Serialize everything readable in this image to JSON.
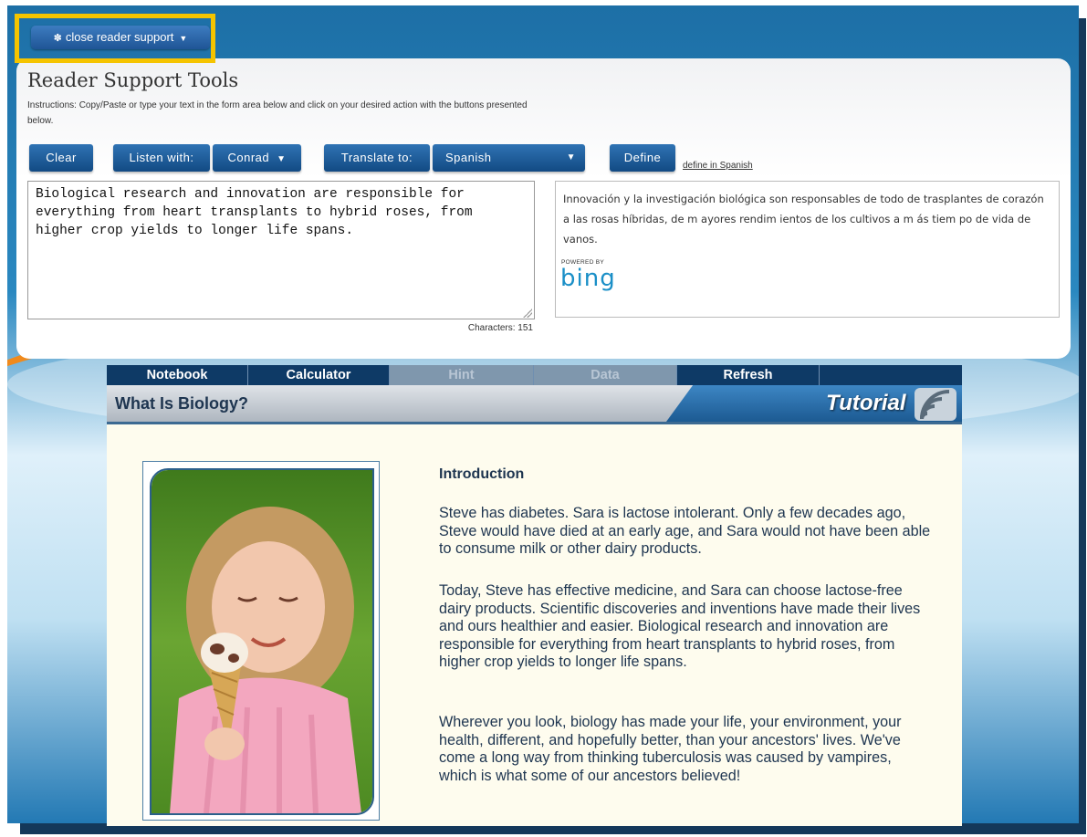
{
  "reader_support": {
    "close_label": "close reader support",
    "title": "Reader Support Tools",
    "instructions": "Instructions: Copy/Paste or type your text in the form area below and click on your desired action with the buttons presented below.",
    "clear_label": "Clear",
    "listen_label": "Listen with:",
    "voice": "Conrad",
    "translate_label": "Translate to:",
    "language": "Spanish",
    "define_label": "Define",
    "define_link": "define in Spanish",
    "input_text": "Biological research and innovation are responsible for everything from heart transplants to hybrid roses, from higher crop yields to longer life spans.",
    "char_count": "Characters: 151",
    "translation": "Innovación y la investigación biológica son responsables de todo de trasplantes de corazón a las rosas híbridas, de m ayores rendim ientos de los cultivos a m ás tiem po de vida de vanos.",
    "powered_by": "POWERED BY",
    "bing": "bing"
  },
  "tutorial": {
    "nav": [
      {
        "label": "Notebook",
        "enabled": true
      },
      {
        "label": "Calculator",
        "enabled": true
      },
      {
        "label": "Hint",
        "enabled": false
      },
      {
        "label": "Data",
        "enabled": false
      },
      {
        "label": "Refresh",
        "enabled": true
      }
    ],
    "title": "What Is Biology?",
    "label": "Tutorial",
    "intro_heading": "Introduction",
    "paragraphs": [
      "Steve has diabetes. Sara is lactose intolerant. Only a few decades ago, Steve would have died at an early age, and Sara would not have been able to consume milk or other dairy products.",
      "Today, Steve has effective medicine, and Sara can choose lactose-free dairy products. Scientific discoveries and inventions have made their lives and ours healthier and easier. Biological research and innovation are responsible for everything from heart transplants to hybrid roses, from higher crop yields to longer life spans.",
      "Wherever you look, biology has made your life, your environment, your health, different, and hopefully better, than your ancestors' lives. We've come a long way from thinking tuberculosis was caused by vampires, which is what some of our ancestors believed!"
    ]
  },
  "colors": {
    "highlight": "#f5c400",
    "button": "#1f5596",
    "nav": "#0e3a66"
  }
}
